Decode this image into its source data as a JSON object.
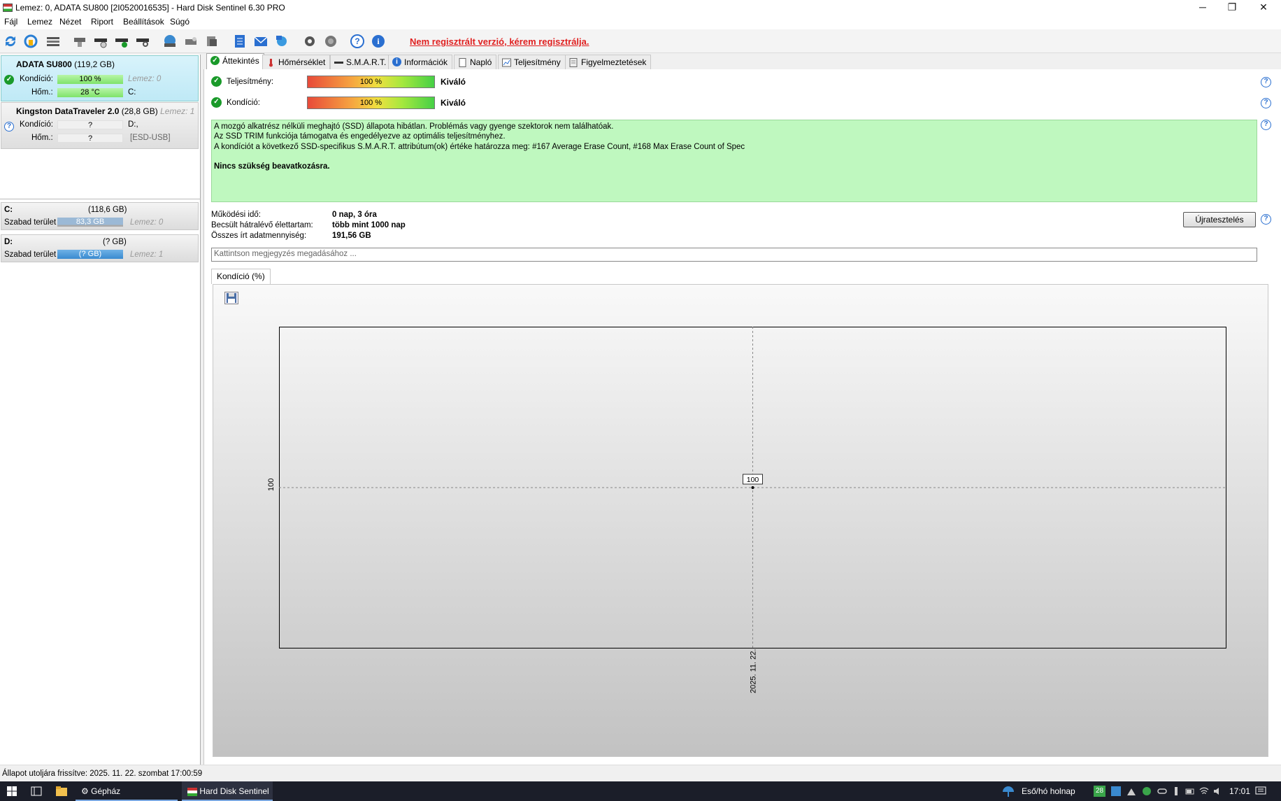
{
  "window": {
    "title": "Lemez: 0, ADATA SU800 [2I0520016535]  -  Hard Disk Sentinel 6.30 PRO",
    "minimize_glyph": "─",
    "maximize_glyph": "❐",
    "close_glyph": "✕"
  },
  "menu": [
    "Fájl",
    "Lemez",
    "Nézet",
    "Riport",
    "Beállítások",
    "Súgó"
  ],
  "toolbar": {
    "unregistered": "Nem regisztrált verzió, kérem regisztrálja."
  },
  "disks": [
    {
      "name": "ADATA SU800",
      "size": "(119,2 GB)",
      "health_label": "Kondíció:",
      "health_value": "100 %",
      "health_level": 1.0,
      "disk_index": "Lemez: 0",
      "temp_label": "Hőm.:",
      "temp_value": "28 °C",
      "drive": "C:"
    },
    {
      "name": "Kingston DataTraveler 2.0",
      "size": "(28,8 GB)",
      "disk_index": "Lemez: 1",
      "health_label": "Kondíció:",
      "health_value": "?",
      "drive": "D:,",
      "temp_label": "Hőm.:",
      "temp_value": "?",
      "bus": "[ESD-USB]"
    }
  ],
  "volumes": [
    {
      "letter": "C:",
      "size": "(118,6 GB)",
      "free_label": "Szabad terület",
      "free_value": "83,3 GB",
      "free_fraction": 0.7,
      "disk_index": "Lemez: 0"
    },
    {
      "letter": "D:",
      "size": "(? GB)",
      "free_label": "Szabad terület",
      "free_value": "(? GB)",
      "disk_index": "Lemez: 1"
    }
  ],
  "tabs": [
    "Áttekintés",
    "Hőmérséklet",
    "S.M.A.R.T.",
    "Információk",
    "Napló",
    "Teljesítmény",
    "Figyelmeztetések"
  ],
  "overview": {
    "performance_label": "Teljesítmény:",
    "performance_value": "100 %",
    "performance_rating": "Kiváló",
    "health_label": "Kondíció:",
    "health_value": "100 %",
    "health_rating": "Kiváló",
    "summary_lines": [
      "A mozgó alkatrész nélküli meghajtó (SSD) állapota hibátlan. Problémás vagy gyenge szektorok nem találhatóak.",
      "Az SSD TRIM funkciója támogatva és engedélyezve az optimális teljesítményhez.",
      "A kondíciót a következő SSD-specifikus S.M.A.R.T. attribútum(ok) értéke határozza meg:  #167 Average Erase Count, #168 Max Erase Count of Spec"
    ],
    "summary_action": "Nincs szükség beavatkozásra.",
    "uptime_label": "Működési idő:",
    "uptime_value": "0 nap, 3 óra",
    "lifetime_label": "Becsült hátralévő élettartam:",
    "lifetime_value": "több mint 1000 nap",
    "written_label": "Összes írt adatmennyiség:",
    "written_value": "191,56 GB",
    "retest_button": "Újratesztelés",
    "note_placeholder": "Kattintson megjegyzés megadásához ..."
  },
  "chart_tab": "Kondíció  (%)",
  "chart_data": {
    "type": "line",
    "x": [
      "2025. 11. 22."
    ],
    "series": [
      {
        "values": [
          100
        ]
      }
    ],
    "ytick_labels": [
      "100"
    ],
    "xtick_labels": [
      "2025. 11. 22."
    ],
    "data_labels": [
      "100"
    ],
    "grid": true
  },
  "status": "Állapot utoljára frissítve: 2025. 11. 22. szombat 17:00:59",
  "taskbar": {
    "settings_app": "Gépház",
    "active_app": "Hard Disk Sentinel",
    "weather": "Eső/hó holnap",
    "badge": "28",
    "time": "17:01"
  },
  "colors": {
    "unregistered_text": "#e02020",
    "summary_bg": "#bff8bf",
    "selected_disk_bg": "#bfe9f6",
    "ok_icon": "#1a9a2a",
    "taskbar_bg": "#1b1e29"
  }
}
